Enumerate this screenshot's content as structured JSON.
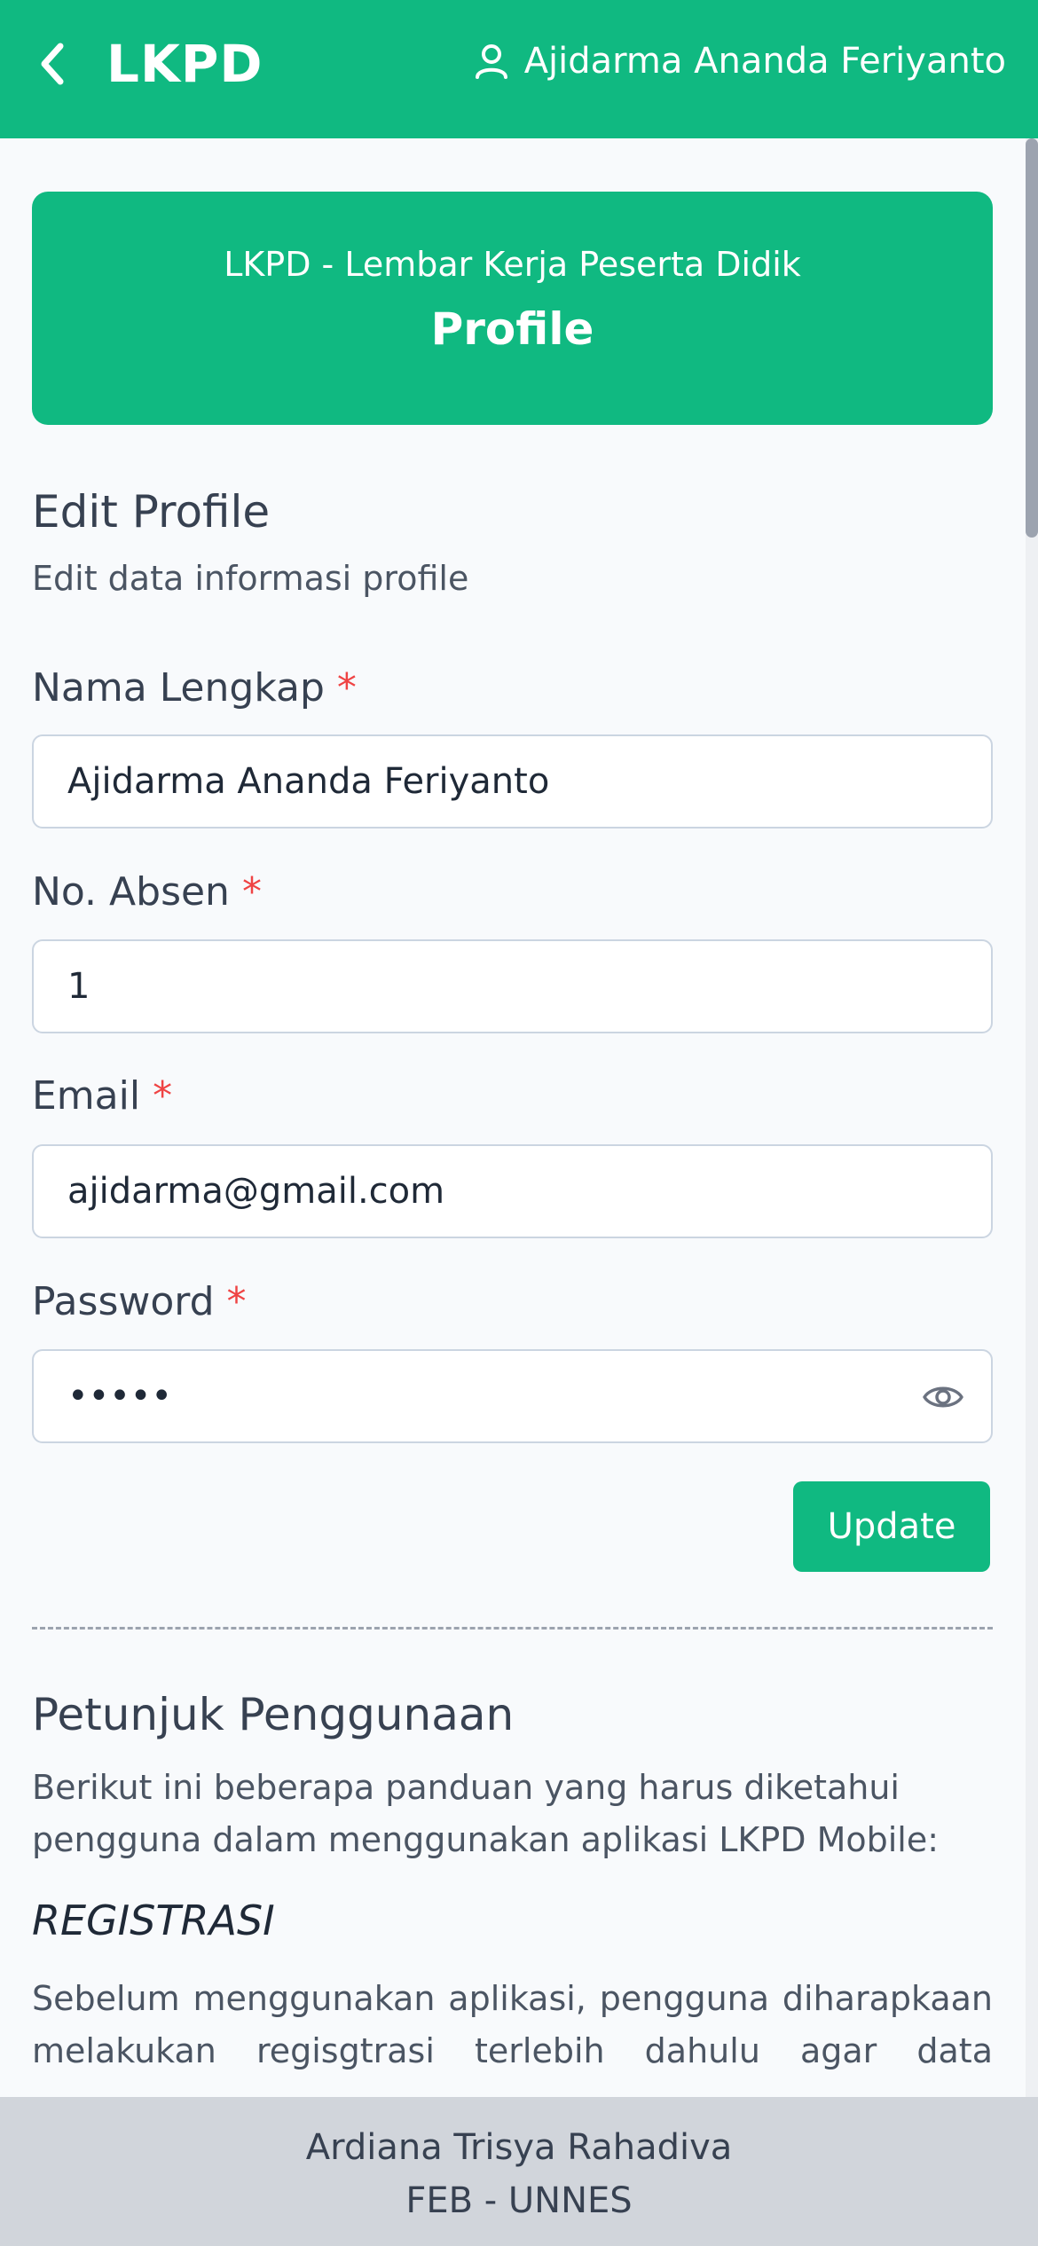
{
  "header": {
    "title": "LKPD",
    "user_name": "Ajidarma Ananda Feriyanto"
  },
  "banner": {
    "subtitle": "LKPD - Lembar Kerja Peserta Didik",
    "title": "Profile"
  },
  "form": {
    "heading": "Edit Profile",
    "description": "Edit data informasi profile",
    "required_mark": "*",
    "fields": {
      "name": {
        "label": "Nama Lengkap",
        "value": "Ajidarma Ananda Feriyanto"
      },
      "absen": {
        "label": "No. Absen",
        "value": "1"
      },
      "email": {
        "label": "Email",
        "value": "ajidarma@gmail.com"
      },
      "password": {
        "label": "Password",
        "value": "12345"
      }
    },
    "update_label": "Update"
  },
  "guide": {
    "heading": "Petunjuk Penggunaan",
    "intro_line1": "Berikut ini beberapa panduan yang harus diketahui",
    "intro_line2": "pengguna dalam menggunakan aplikasi LKPD Mobile:",
    "section_title": "REGISTRASI",
    "section_line1": "Sebelum menggunakan aplikasi, pengguna diharapkaan",
    "section_line2": "melakukan regisgtrasi terlebih dahulu agar data"
  },
  "footer": {
    "name": "Ardiana Trisya Rahadiva",
    "org": "FEB - UNNES"
  },
  "colors": {
    "primary": "#10b981",
    "required": "#ef4444",
    "footer_bg": "#d1d5db"
  },
  "icons": {
    "back": "chevron-left-icon",
    "user": "user-icon",
    "password_toggle": "eye-icon"
  }
}
